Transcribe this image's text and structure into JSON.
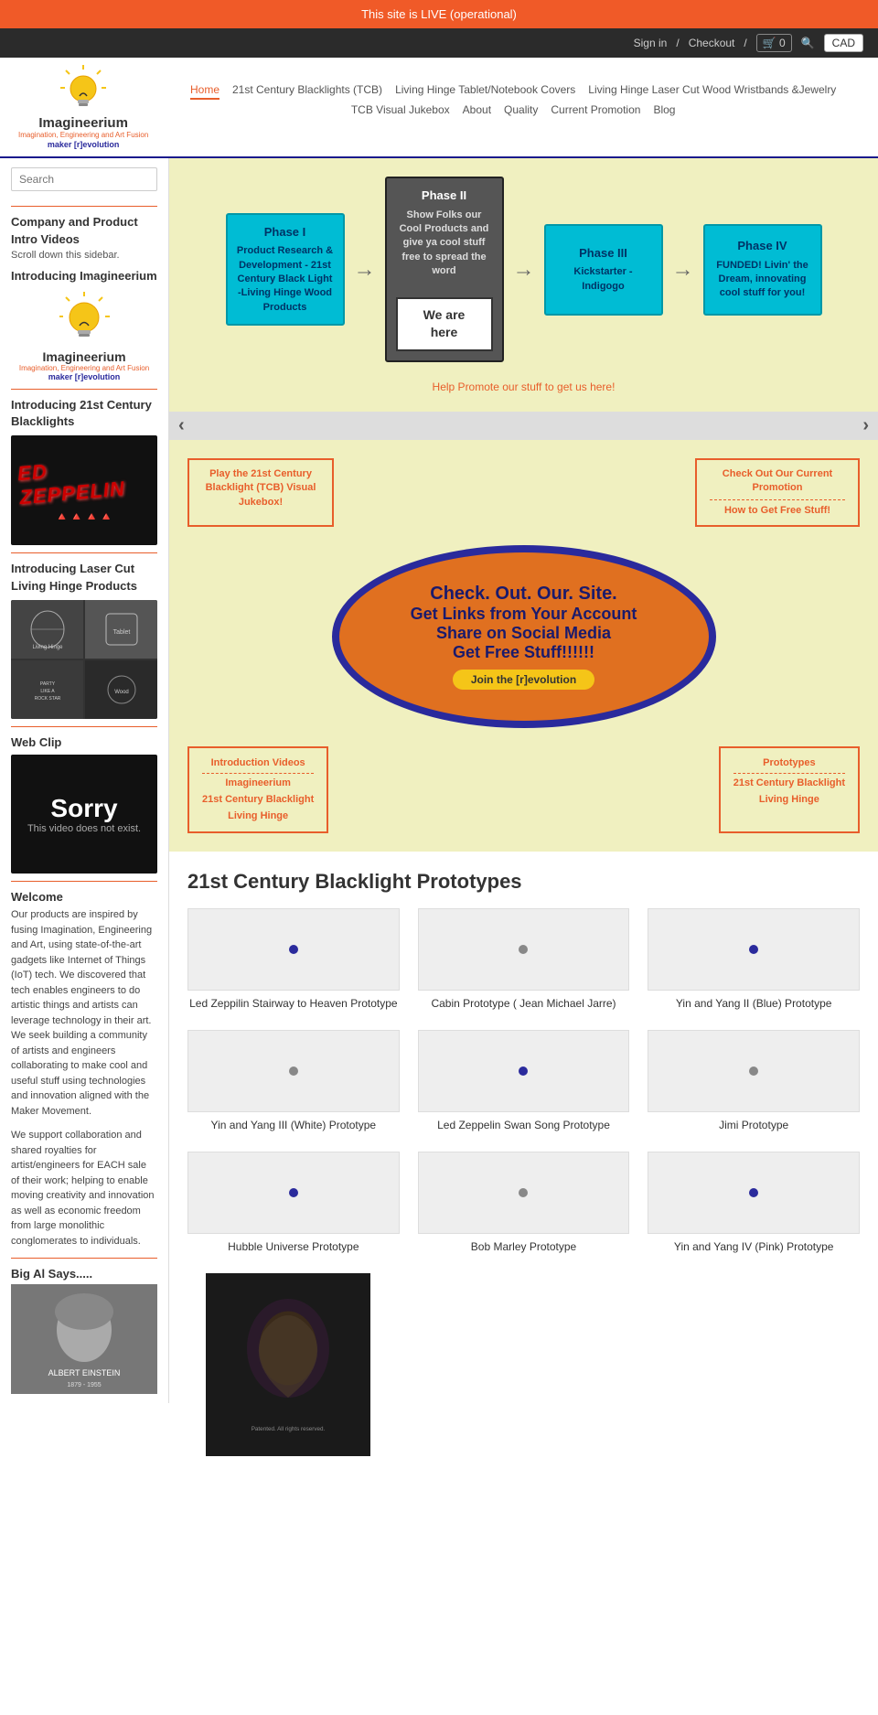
{
  "top_banner": {
    "text": "This site is LIVE (operational)"
  },
  "header": {
    "sign_in": "Sign in",
    "separator": "/",
    "checkout": "Checkout",
    "cart_count": "0",
    "currency": "CAD"
  },
  "nav": {
    "logo_text": "Imagineerium",
    "logo_tagline": "Imagination, Engineering and Art Fusion",
    "logo_maker": "maker [r]evolution",
    "nav_items": [
      {
        "label": "Home",
        "active": true
      },
      {
        "label": "21st Century Blacklights (TCB)",
        "active": false
      },
      {
        "label": "Living Hinge Tablet/Notebook Covers",
        "active": false
      },
      {
        "label": "Living Hinge Laser Cut Wood Wristbands &Jewelry",
        "active": false
      },
      {
        "label": "TCB Visual Jukebox",
        "active": false
      },
      {
        "label": "About",
        "active": false
      },
      {
        "label": "Quality",
        "active": false
      },
      {
        "label": "Current Promotion",
        "active": false
      },
      {
        "label": "Blog",
        "active": false
      }
    ]
  },
  "sidebar": {
    "search_placeholder": "Search",
    "company_section": "Company and Product Intro Videos",
    "scroll_hint": "Scroll down this sidebar.",
    "introducing_imagineerium": "Introducing Imagineerium",
    "introducing_blacklights": "Introducing 21st Century Blacklights",
    "introducing_laser": "Introducing Laser Cut Living Hinge Products",
    "web_clip_title": "Web Clip",
    "web_clip_sorry": "Sorry",
    "web_clip_sub": "This video does not exist."
  },
  "hero": {
    "phase1_title": "Phase I",
    "phase1_body": "Product Research & Development - 21st Century Black Light -Living Hinge Wood Products",
    "phase2_title": "Phase II",
    "phase2_body": "Show Folks our Cool Products and give ya cool stuff free to spread the word",
    "phase3_title": "Phase III",
    "phase3_body": "Kickstarter - Indigogo",
    "phase4_title": "Phase IV",
    "phase4_body": "FUNDED! Livin' the Dream, innovating cool stuff for you!",
    "we_are_here": "We are here",
    "help_promote": "Help Promote our stuff to get us here!",
    "promo_btn_left": "Play the 21st Century Blacklight (TCB) Visual Jukebox!",
    "promo_btn_right_line1": "Check Out Our Current Promotion",
    "promo_btn_right_line2": "How to Get Free Stuff!",
    "oval_line1": "Check. Out. Our. Site.",
    "oval_line2": "Get Links from Your Account",
    "oval_line3": "Share on Social Media",
    "oval_line4": "Get Free Stuff!!!!!!",
    "oval_join": "Join the [r]evolution",
    "bottom_left_line1": "Introduction Videos",
    "bottom_left_line2": "Imagineerium",
    "bottom_left_line3": "21st Century Blacklight",
    "bottom_left_line4": "Living Hinge",
    "bottom_right_line1": "Prototypes",
    "bottom_right_line2": "21st Century Blacklight",
    "bottom_right_line3": "Living Hinge"
  },
  "prototypes": {
    "section_title": "21st Century Blacklight Prototypes",
    "items": [
      {
        "label": "Led Zeppilin Stairway to Heaven Prototype"
      },
      {
        "label": "Cabin Prototype ( Jean Michael Jarre)"
      },
      {
        "label": "Yin and Yang II (Blue) Prototype"
      },
      {
        "label": "Yin and Yang III (White) Prototype"
      },
      {
        "label": "Led Zeppelin Swan Song Prototype"
      },
      {
        "label": "Jimi Prototype"
      },
      {
        "label": "Hubble Universe Prototype"
      },
      {
        "label": "Bob Marley Prototype"
      },
      {
        "label": "Yin and Yang IV (Pink) Prototype"
      }
    ]
  },
  "welcome": {
    "title": "Welcome",
    "paragraph1": "Our products are inspired by fusing Imagination, Engineering and Art, using state-of-the-art gadgets like Internet of Things (IoT) tech. We discovered that tech enables engineers to do artistic things and artists can leverage technology in their art.  We seek building a community of artists and engineers collaborating to make cool and useful stuff using technologies and innovation aligned with the Maker Movement.",
    "paragraph2": "We support collaboration and shared royalties for artist/engineers for EACH sale of their work; helping to enable moving creativity and innovation as well as economic freedom from large monolithic conglomerates to individuals."
  },
  "big_al": {
    "title": "Big Al Says....."
  }
}
